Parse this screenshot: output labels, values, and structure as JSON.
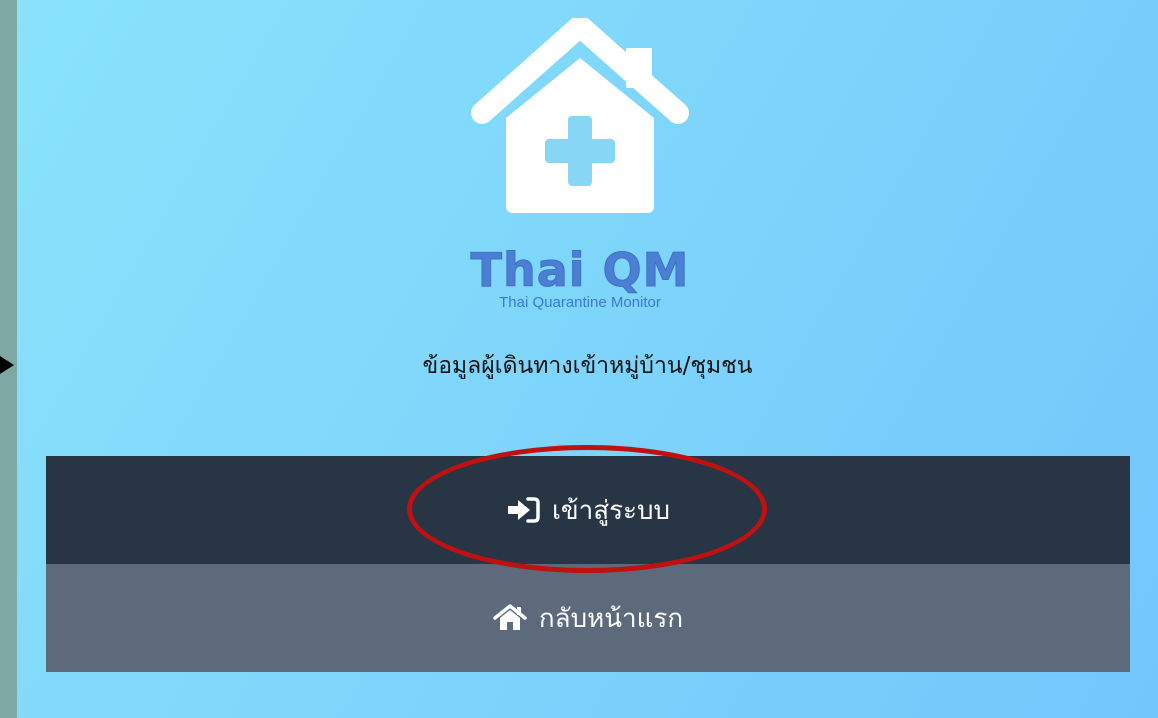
{
  "brand": {
    "title": "Thai QM",
    "subtitle": "Thai Quarantine Monitor"
  },
  "heading": "ข้อมูลผู้เดินทางเข้าหมู่บ้าน/ชุมชน",
  "buttons": {
    "login": {
      "label": "เข้าสู่ระบบ",
      "icon": "sign-in-icon"
    },
    "home": {
      "label": "กลับหน้าแรก",
      "icon": "home-icon"
    }
  },
  "colors": {
    "login_bg": "#273545",
    "home_bg": "#5c6a7b",
    "brand_blue": "#4a7fd4",
    "highlight": "#c01010"
  }
}
